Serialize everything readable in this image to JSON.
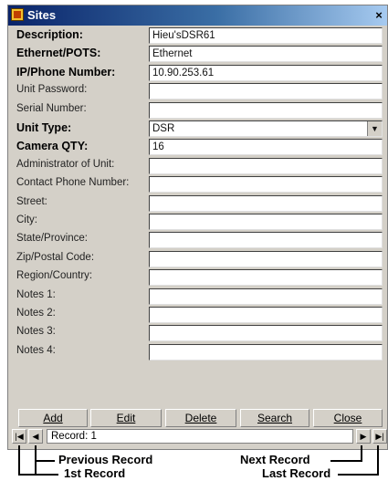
{
  "window": {
    "title": "Sites",
    "close_glyph": "×",
    "icon": "app-icon"
  },
  "fields": [
    {
      "label": "Description:",
      "bold": true,
      "value": "Hieu'sDSR61"
    },
    {
      "label": "Ethernet/POTS:",
      "bold": true,
      "value": "Ethernet"
    },
    {
      "label": "IP/Phone Number:",
      "bold": true,
      "value": "10.90.253.61"
    },
    {
      "label": "Unit Password:",
      "bold": false,
      "value": ""
    },
    {
      "label": "Serial Number:",
      "bold": false,
      "value": ""
    },
    {
      "label": "Unit Type:",
      "bold": true,
      "value": "DSR",
      "dropdown": true
    },
    {
      "label": "Camera QTY:",
      "bold": true,
      "value": "16"
    },
    {
      "label": "Administrator of Unit:",
      "bold": false,
      "value": ""
    },
    {
      "label": "Contact Phone Number:",
      "bold": false,
      "value": ""
    },
    {
      "label": "Street:",
      "bold": false,
      "value": ""
    },
    {
      "label": "City:",
      "bold": false,
      "value": ""
    },
    {
      "label": "State/Province:",
      "bold": false,
      "value": ""
    },
    {
      "label": "Zip/Postal Code:",
      "bold": false,
      "value": ""
    },
    {
      "label": "Region/Country:",
      "bold": false,
      "value": ""
    },
    {
      "label": "Notes 1:",
      "bold": false,
      "value": ""
    },
    {
      "label": "Notes 2:",
      "bold": false,
      "value": ""
    },
    {
      "label": "Notes 3:",
      "bold": false,
      "value": ""
    },
    {
      "label": "Notes 4:",
      "bold": false,
      "value": ""
    }
  ],
  "buttons": {
    "add": "Add",
    "edit": "Edit",
    "delete": "Delete",
    "search": "Search",
    "close": "Close"
  },
  "navigation": {
    "record_text": "Record: 1",
    "first_glyph": "|◀",
    "prev_glyph": "◀",
    "next_glyph": "▶",
    "last_glyph": "▶|"
  },
  "annotations": {
    "previous_record": "Previous Record",
    "next_record": "Next Record",
    "first_record": "1st Record",
    "last_record": "Last Record"
  }
}
